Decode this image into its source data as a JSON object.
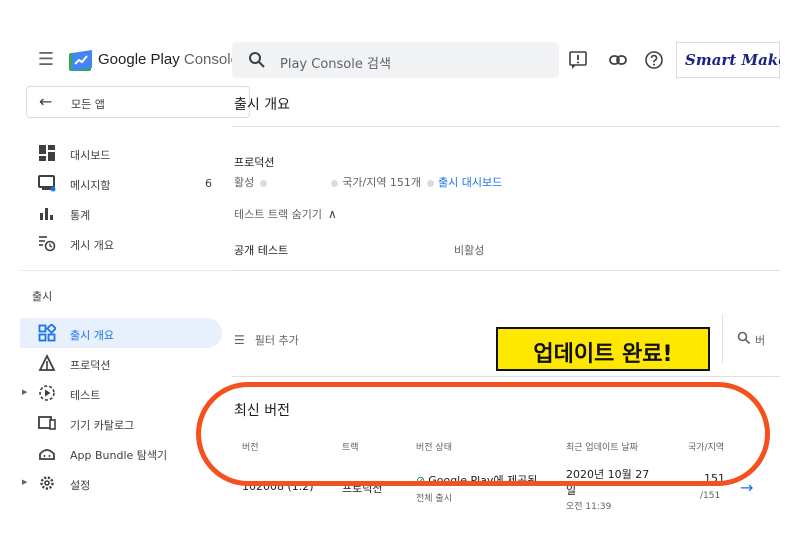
{
  "header": {
    "product_prefix": "Google Play",
    "product_suffix": " Console",
    "search_placeholder": "Play Console 검색",
    "brand": "Smart Maker"
  },
  "sidebar": {
    "back_label": "모든 앱",
    "items": [
      {
        "label": "대시보드",
        "icon": "dashboard-icon"
      },
      {
        "label": "메시지함",
        "count": "6",
        "icon": "inbox-icon"
      },
      {
        "label": "통계",
        "icon": "bar-chart-icon"
      },
      {
        "label": "게시 개요",
        "icon": "publishing-icon"
      }
    ],
    "section_release": "출시",
    "release_items": [
      {
        "label": "출시 개요",
        "icon": "release-overview-icon",
        "active": true
      },
      {
        "label": "프로덕션",
        "icon": "production-icon"
      },
      {
        "label": "테스트",
        "icon": "testing-icon",
        "expandable": true
      },
      {
        "label": "기기 카탈로그",
        "icon": "device-catalog-icon"
      },
      {
        "label": "App Bundle 탐색기",
        "icon": "bundle-explorer-icon"
      },
      {
        "label": "설정",
        "icon": "settings-icon",
        "expandable": true
      }
    ]
  },
  "main": {
    "page_title": "출시 개요",
    "production_label": "프로덕션",
    "production_status": "활성",
    "countries": "국가/지역 151개",
    "release_dashboard_link": "출시 대시보드",
    "hide_tracks": "테스트 트랙 숨기기",
    "open_test_label": "공개 테스트",
    "open_test_status": "비활성",
    "filter_label": "필터 추가",
    "side_search_text": "버",
    "latest_title": "최신 버전",
    "columns": [
      "버전",
      "트랙",
      "버전 상태",
      "최근 업데이트 날짜",
      "국가/지역"
    ],
    "row": {
      "version": "102008 (1.2)",
      "track": "프로덕션",
      "status": "Google Play에 제공됨",
      "status_sub": "전체 출시",
      "date_line1": "2020년 10월 27",
      "date_line2": "일",
      "time": "오전 11:39",
      "countries_top": "151",
      "countries_bottom": "/151"
    }
  },
  "callout": {
    "text": "업데이트 완료!"
  },
  "colors": {
    "accent": "#1a73e8",
    "callout_bg": "#ffe800",
    "highlight_ring": "#f4511e",
    "status_green": "#188038"
  }
}
